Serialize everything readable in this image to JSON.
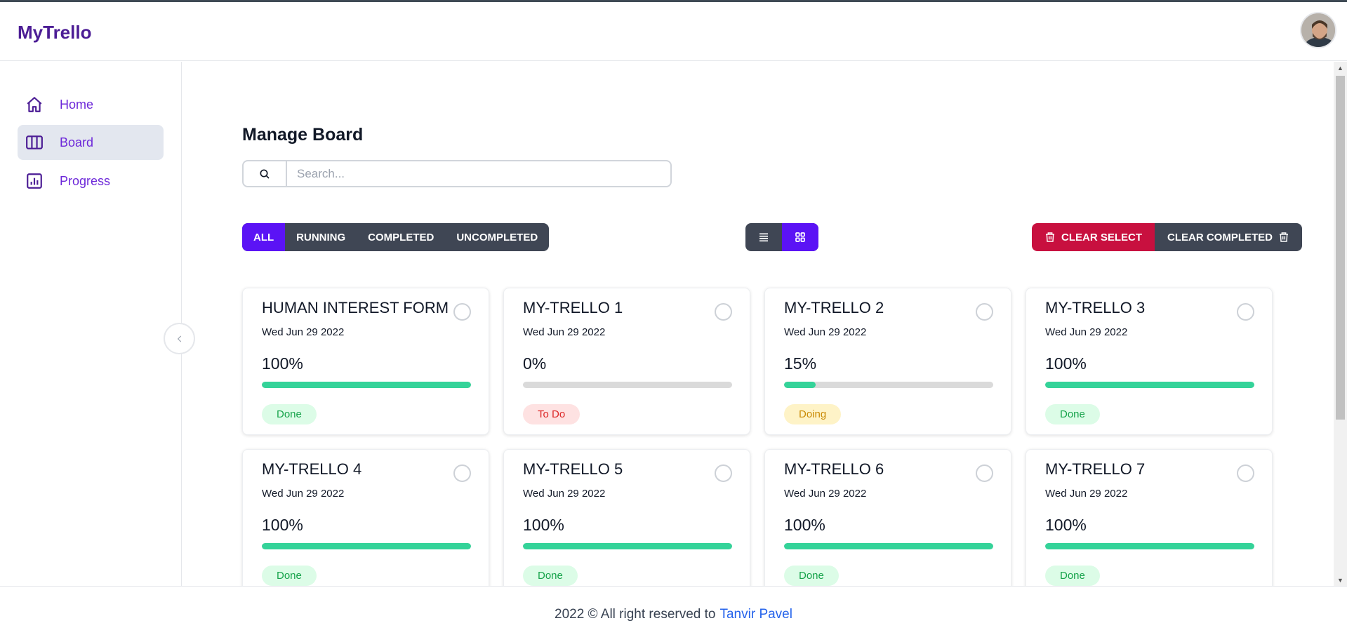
{
  "app": {
    "logo": "MyTrello"
  },
  "sidebar": {
    "items": [
      {
        "label": "Home",
        "icon": "home-icon"
      },
      {
        "label": "Board",
        "icon": "board-columns-icon",
        "active": true
      },
      {
        "label": "Progress",
        "icon": "chart-icon"
      }
    ]
  },
  "main": {
    "title": "Manage Board",
    "search": {
      "placeholder": "Search...",
      "value": ""
    },
    "filters": [
      "ALL",
      "RUNNING",
      "COMPLETED",
      "UNCOMPLETED"
    ],
    "active_filter": "ALL",
    "view_modes": [
      "list-view-icon",
      "grid-view-icon"
    ],
    "active_view": "grid-view-icon",
    "actions": {
      "clear_select": "CLEAR SELECT",
      "clear_completed": "CLEAR COMPLETED"
    },
    "cards": [
      {
        "title": "HUMAN INTEREST FORM",
        "date": "Wed Jun 29 2022",
        "percent_text": "100%",
        "progress": 100,
        "status": "Done",
        "status_type": "done"
      },
      {
        "title": "MY-TRELLO 1",
        "date": "Wed Jun 29 2022",
        "percent_text": "0%",
        "progress": 0,
        "status": "To Do",
        "status_type": "todo"
      },
      {
        "title": "MY-TRELLO 2",
        "date": "Wed Jun 29 2022",
        "percent_text": "15%",
        "progress": 15,
        "status": "Doing",
        "status_type": "doing"
      },
      {
        "title": "MY-TRELLO 3",
        "date": "Wed Jun 29 2022",
        "percent_text": "100%",
        "progress": 100,
        "status": "Done",
        "status_type": "done"
      },
      {
        "title": "MY-TRELLO 4",
        "date": "Wed Jun 29 2022",
        "percent_text": "100%",
        "progress": 100,
        "status": "Done",
        "status_type": "done"
      },
      {
        "title": "MY-TRELLO 5",
        "date": "Wed Jun 29 2022",
        "percent_text": "100%",
        "progress": 100,
        "status": "Done",
        "status_type": "done"
      },
      {
        "title": "MY-TRELLO 6",
        "date": "Wed Jun 29 2022",
        "percent_text": "100%",
        "progress": 100,
        "status": "Done",
        "status_type": "done"
      },
      {
        "title": "MY-TRELLO 7",
        "date": "Wed Jun 29 2022",
        "percent_text": "100%",
        "progress": 100,
        "status": "Done",
        "status_type": "done"
      }
    ]
  },
  "footer": {
    "text": "2022 © All right reserved to",
    "author": "Tanvir Pavel"
  },
  "colors": {
    "accent": "#5b13f5",
    "brand": "#4c1d95",
    "danger": "#c8103f",
    "success": "#34d399"
  }
}
